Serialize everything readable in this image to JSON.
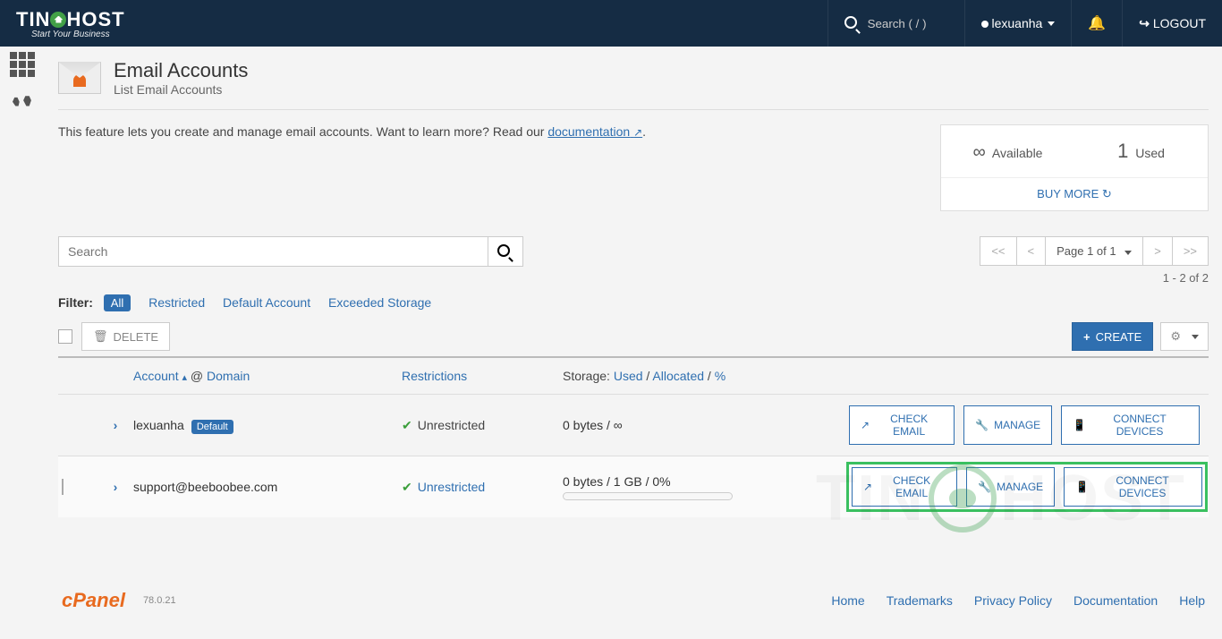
{
  "brand": {
    "name": "TINOHOST",
    "tagline": "Start Your Business"
  },
  "topbar": {
    "search_placeholder": "Search ( / )",
    "user": "lexuanha",
    "logout": "LOGOUT"
  },
  "page": {
    "title": "Email Accounts",
    "subtitle": "List Email Accounts",
    "intro_prefix": "This feature lets you create and manage email accounts. Want to learn more? Read our ",
    "intro_link": "documentation",
    "intro_suffix": "."
  },
  "stats": {
    "available_label": "Available",
    "used_value": "1",
    "used_label": "Used",
    "buy": "BUY MORE"
  },
  "search": {
    "placeholder": "Search"
  },
  "pager": {
    "first": "<<",
    "prev": "<",
    "label": "Page 1 of 1",
    "next": ">",
    "last": ">>",
    "range": "1 - 2 of 2"
  },
  "filters": {
    "label": "Filter:",
    "all": "All",
    "restricted": "Restricted",
    "default": "Default Account",
    "exceeded": "Exceeded Storage"
  },
  "actions": {
    "delete": "DELETE",
    "create": "CREATE"
  },
  "columns": {
    "account": "Account",
    "at": "@",
    "domain": "Domain",
    "restrictions": "Restrictions",
    "storage_label": "Storage:",
    "used": "Used",
    "allocated": "Allocated",
    "percent": "%"
  },
  "rowbtn": {
    "check": "CHECK EMAIL",
    "manage": "MANAGE",
    "connect": "CONNECT DEVICES"
  },
  "rows": [
    {
      "account": "lexuanha",
      "badge": "Default",
      "restriction": "Unrestricted",
      "restriction_link": false,
      "storage_text": "0 bytes / ∞",
      "has_checkbox": false,
      "has_progress": false,
      "highlight": false
    },
    {
      "account": "support@beeboobee.com",
      "badge": "",
      "restriction": "Unrestricted",
      "restriction_link": true,
      "storage_text": "0 bytes / 1 GB / 0%",
      "has_checkbox": true,
      "has_progress": true,
      "highlight": true
    }
  ],
  "footer": {
    "brand": "cPanel",
    "version": "78.0.21",
    "links": [
      "Home",
      "Trademarks",
      "Privacy Policy",
      "Documentation",
      "Help"
    ]
  },
  "watermark": {
    "pre": "TIN",
    "post": "HOST"
  }
}
